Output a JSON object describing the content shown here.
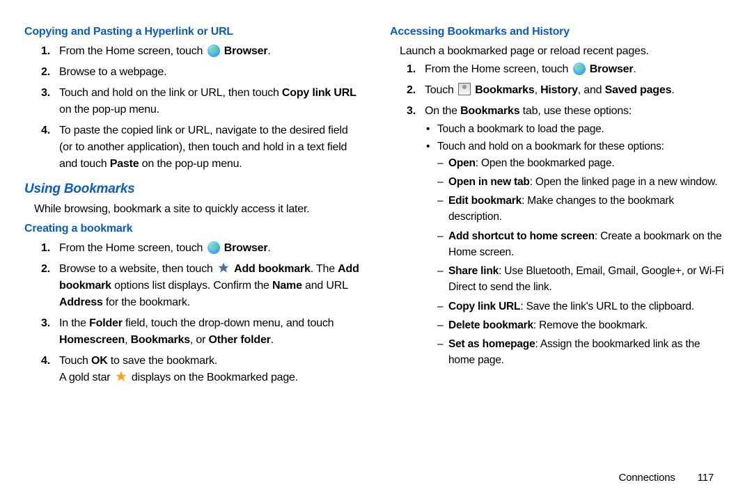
{
  "left": {
    "h_copy": "Copying and Pasting a Hyperlink or URL",
    "copy_steps": {
      "s1a": "From the Home screen, touch ",
      "s1b": "Browser",
      "s1c": ".",
      "s2": "Browse to a webpage.",
      "s3a": "Touch and hold on the link or URL, then touch ",
      "s3b": "Copy link URL",
      "s3c": " on the pop-up menu.",
      "s4a": "To paste the copied link or URL, navigate to the desired field (or to another application), then touch and hold in a text field and touch ",
      "s4b": "Paste",
      "s4c": " on the pop-up menu."
    },
    "h_using": "Using Bookmarks",
    "using_intro": "While browsing, bookmark a site to quickly access it later.",
    "h_create": "Creating a bookmark",
    "create_steps": {
      "s1a": "From the Home screen, touch ",
      "s1b": "Browser",
      "s1c": ".",
      "s2a": "Browse to a website, then touch ",
      "s2b": "Add bookmark",
      "s2c": ". The ",
      "s2d": "Add bookmark",
      "s2e": " options list displays. Confirm the ",
      "s2f": "Name",
      "s2g": " and URL ",
      "s2h": "Address",
      "s2i": " for the bookmark.",
      "s3a": "In the ",
      "s3b": "Folder",
      "s3c": " field, touch the drop-down menu, and touch ",
      "s3d": "Homescreen",
      "s3e": ", ",
      "s3f": "Bookmarks",
      "s3g": ", or ",
      "s3h": "Other folder",
      "s3i": ".",
      "s4a": "Touch ",
      "s4b": "OK",
      "s4c": " to save the bookmark.",
      "s4d": "A gold star ",
      "s4e": " displays on the Bookmarked page."
    }
  },
  "right": {
    "h_access": "Accessing Bookmarks and History",
    "access_intro": "Launch a bookmarked page or reload recent pages.",
    "steps": {
      "s1a": "From the Home screen, touch ",
      "s1b": "Browser",
      "s1c": ".",
      "s2a": "Touch ",
      "s2b": "Bookmarks",
      "s2c": ", ",
      "s2d": "History",
      "s2e": ", and ",
      "s2f": "Saved pages",
      "s2g": ".",
      "s3a": "On the ",
      "s3b": "Bookmarks",
      "s3c": " tab, use these options:"
    },
    "bullets": {
      "b1": "Touch a bookmark to load the page.",
      "b2": "Touch and hold on a bookmark for these options:"
    },
    "dashes": {
      "d1a": "Open",
      "d1b": ": Open the bookmarked page.",
      "d2a": "Open in new tab",
      "d2b": ": Open the linked page in a new window.",
      "d3a": "Edit bookmark",
      "d3b": ": Make changes to the bookmark description.",
      "d4a": "Add shortcut to home screen",
      "d4b": ": Create a bookmark on the Home screen.",
      "d5a": "Share link",
      "d5b": ": Use Bluetooth, Email, Gmail, Google+, or Wi-Fi Direct to send the link.",
      "d6a": "Copy link URL",
      "d6b": ": Save the link's URL to the clipboard.",
      "d7a": "Delete bookmark",
      "d7b": ": Remove the bookmark.",
      "d8a": "Set as homepage",
      "d8b": ": Assign the bookmarked link as the home page."
    }
  },
  "footer": {
    "section": "Connections",
    "page": "117"
  }
}
